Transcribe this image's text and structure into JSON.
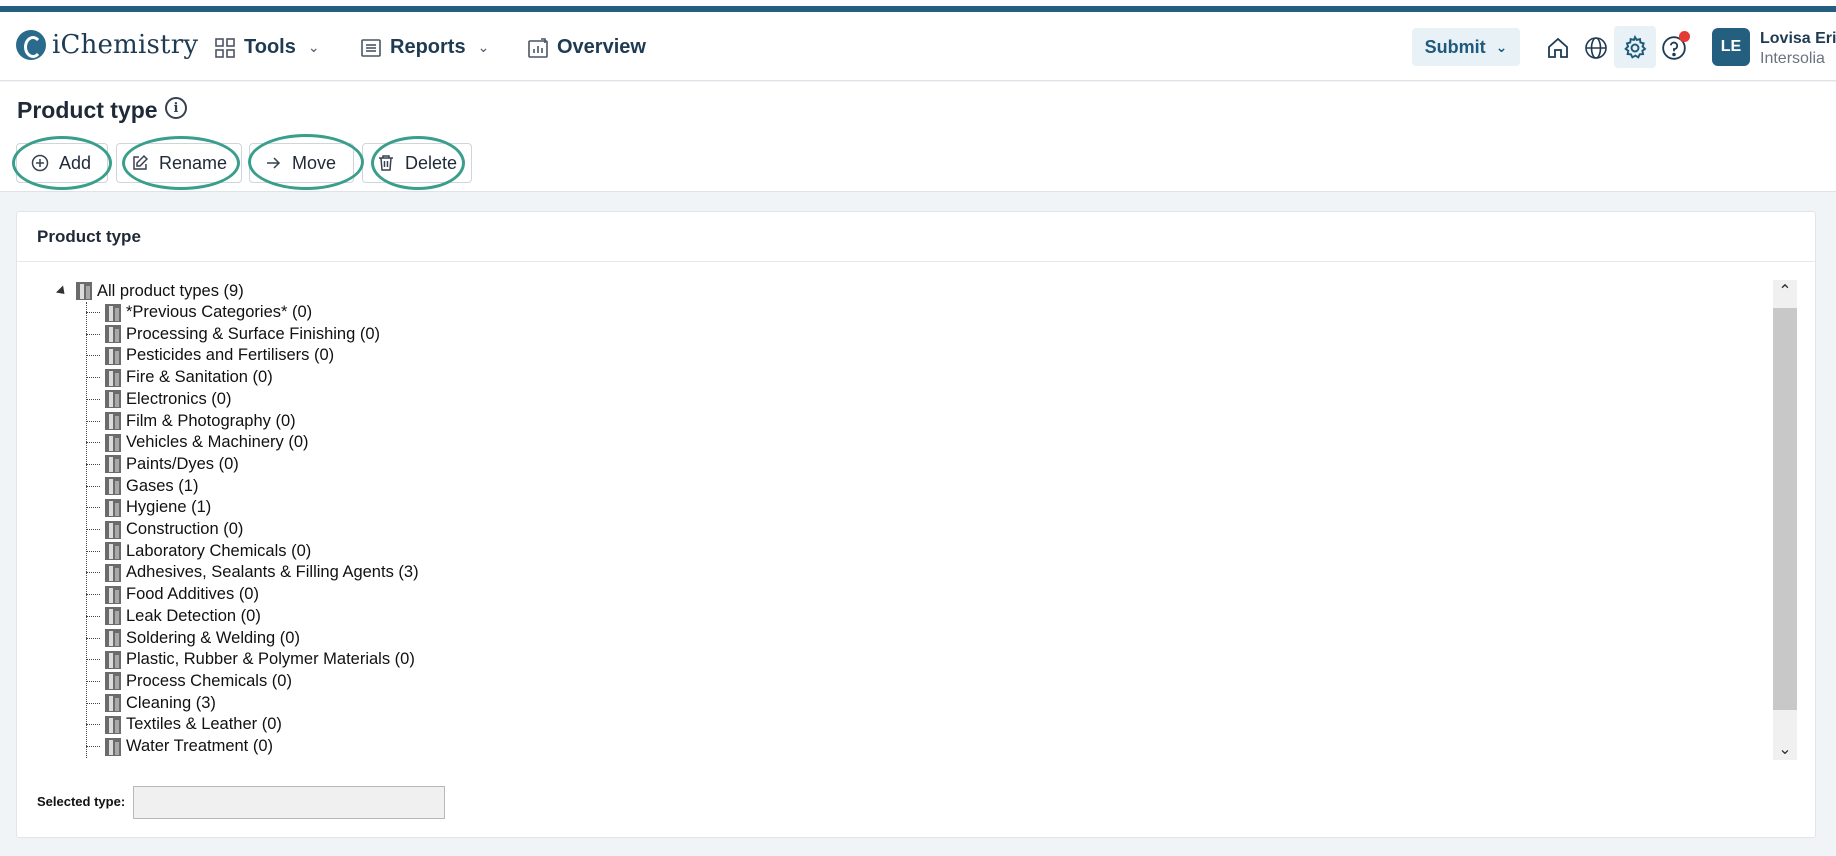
{
  "header": {
    "logo_text": "iChemistry",
    "nav": [
      {
        "label": "Tools",
        "has_dropdown": true
      },
      {
        "label": "Reports",
        "has_dropdown": true
      },
      {
        "label": "Overview",
        "has_dropdown": false
      }
    ],
    "submit_label": "Submit",
    "user": {
      "initials": "LE",
      "name": "Lovisa Erik",
      "org": "Intersolia"
    },
    "notification_color": "#e53935"
  },
  "page": {
    "title": "Product type",
    "toolbar": {
      "add": "Add",
      "rename": "Rename",
      "move": "Move",
      "delete": "Delete"
    },
    "highlight_color": "#3a9e8c"
  },
  "panel": {
    "title": "Product type",
    "tree": {
      "root": "All product types (9)",
      "items": [
        "*Previous Categories* (0)",
        "Processing & Surface Finishing (0)",
        "Pesticides and Fertilisers (0)",
        "Fire & Sanitation (0)",
        "Electronics (0)",
        "Film & Photography (0)",
        "Vehicles & Machinery (0)",
        "Paints/Dyes (0)",
        "Gases (1)",
        "Hygiene (1)",
        "Construction (0)",
        "Laboratory Chemicals (0)",
        "Adhesives, Sealants & Filling Agents (3)",
        "Food Additives (0)",
        "Leak Detection (0)",
        "Soldering & Welding (0)",
        "Plastic, Rubber & Polymer Materials (0)",
        "Process Chemicals (0)",
        "Cleaning (3)",
        "Textiles & Leather (0)",
        "Water Treatment (0)"
      ]
    },
    "selected_label": "Selected type:",
    "selected_value": ""
  }
}
